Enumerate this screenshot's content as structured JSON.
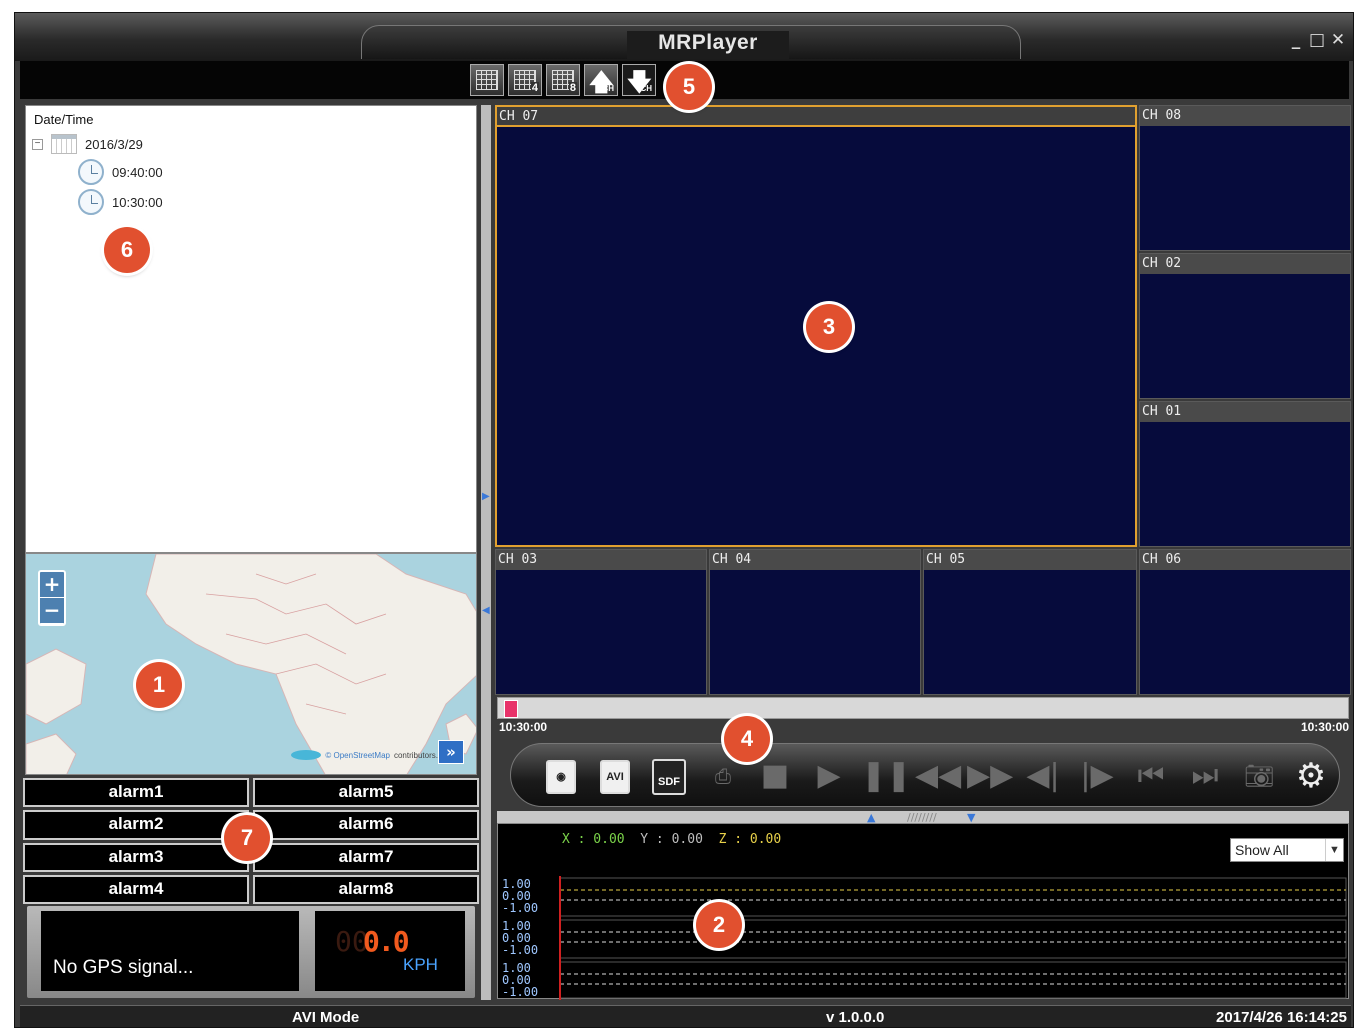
{
  "window": {
    "title": "MRPlayer",
    "buttons": [
      "_",
      "□",
      "✕"
    ]
  },
  "toolbar": {
    "buttons": [
      {
        "name": "layout-1",
        "num": ""
      },
      {
        "name": "layout-4",
        "num": "4"
      },
      {
        "name": "layout-8",
        "num": "8"
      },
      {
        "name": "channel-up",
        "sub": "CH"
      },
      {
        "name": "channel-down",
        "sub": "CH"
      }
    ]
  },
  "tree": {
    "header": "Date/Time",
    "date": "2016/3/29",
    "times": [
      "09:40:00",
      "10:30:00"
    ]
  },
  "map": {
    "zoom_in": "+",
    "zoom_out": "−",
    "attribution_link": "© OpenStreetMap",
    "attribution_rest": "contributors.",
    "expand": "»"
  },
  "alarms": [
    "alarm1",
    "alarm5",
    "alarm2",
    "alarm6",
    "alarm3",
    "alarm7",
    "alarm4",
    "alarm8"
  ],
  "gps": {
    "message": "No GPS signal...",
    "speed_dim": "00",
    "speed": "0.0",
    "unit": "KPH"
  },
  "cameras": {
    "ch07": "CH 07",
    "ch08": "CH 08",
    "ch02": "CH 02",
    "ch01": "CH 01",
    "ch03": "CH 03",
    "ch04": "CH 04",
    "ch05": "CH 05",
    "ch06": "CH 06"
  },
  "timeline": {
    "start": "10:30:00",
    "end": "10:30:00",
    "progress": 0
  },
  "controls": {
    "avi_label": "AVI",
    "sdf_label": "SDF"
  },
  "sensor": {
    "x": "X : 0.00",
    "y": "Y : 0.00",
    "z": "Z : 0.00",
    "filter": "Show All",
    "axis": [
      [
        "1.00",
        "0.00",
        "-1.00"
      ],
      [
        "1.00",
        "0.00",
        "-1.00"
      ],
      [
        "1.00",
        "0.00",
        "-1.00"
      ]
    ]
  },
  "status": {
    "mode": "AVI Mode",
    "version": "v 1.0.0.0",
    "datetime": "2017/4/26 16:14:25"
  },
  "badges": [
    "1",
    "2",
    "3",
    "4",
    "5",
    "6",
    "7"
  ],
  "colors": {
    "accent": "#e1502f",
    "screen": "#060b3c",
    "selected": "#e0a030",
    "speed": "#f25a1e",
    "unit": "#4aa3ff"
  }
}
